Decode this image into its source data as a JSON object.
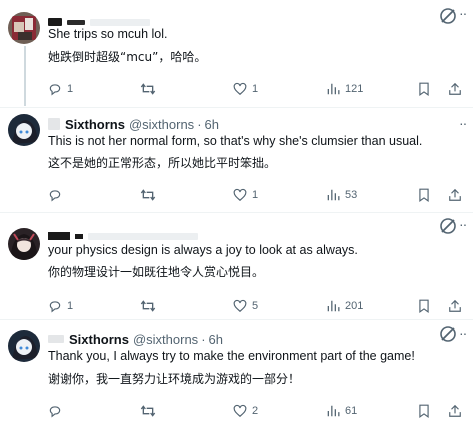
{
  "tweets": [
    {
      "name": "",
      "handle": "",
      "time": "",
      "lines": [
        "She trips so mcuh lol.",
        "她跌倒时超级“mcu”，哈哈。"
      ],
      "replies": "1",
      "retweets": "",
      "likes": "1",
      "views": "121"
    },
    {
      "name": "Sixthorns",
      "handle": "@sixthorns",
      "time": "6h",
      "lines": [
        "This is not her normal form, so that's why she's clumsier than usual.",
        "这不是她的正常形态，所以她比平时笨拙。"
      ],
      "replies": "",
      "retweets": "",
      "likes": "1",
      "views": "53"
    },
    {
      "name": "",
      "handle": "",
      "time": "",
      "lines": [
        "your physics design is always a joy to look at as always.",
        "你的物理设计一如既往地令人赏心悦目。"
      ],
      "replies": "1",
      "retweets": "",
      "likes": "5",
      "views": "201"
    },
    {
      "name": "Sixthorns",
      "handle": "@sixthorns",
      "time": "6h",
      "lines": [
        "Thank you, I always try to make the environment part of the game!",
        "谢谢你，我一直努力让环境成为游戏的一部分！"
      ],
      "replies": "",
      "retweets": "",
      "likes": "2",
      "views": "61"
    }
  ],
  "separator": "·",
  "icons": {
    "reply": "reply-icon",
    "retweet": "retweet-icon",
    "like": "heart-icon",
    "views": "views-icon",
    "bookmark": "bookmark-icon",
    "share": "share-icon",
    "grok": "grok-icon",
    "more": "more-icon"
  },
  "colors": {
    "text": "#0f1419",
    "secondary": "#536471",
    "divider": "#eff3f4",
    "thread_line": "#cfd9de"
  }
}
